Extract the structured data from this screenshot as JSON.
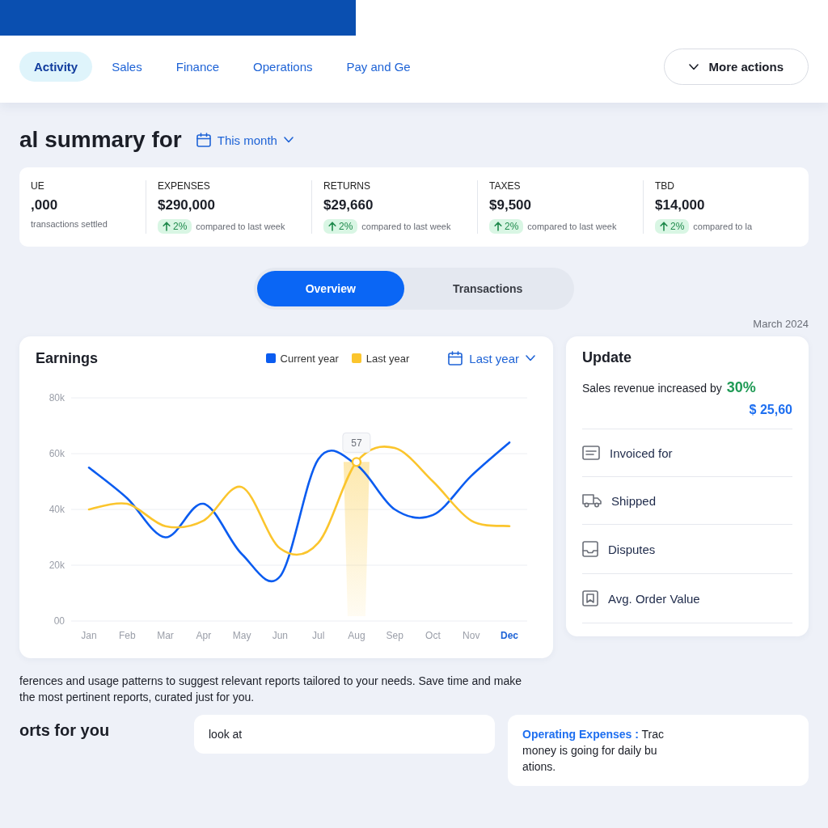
{
  "header": {
    "tabs": [
      {
        "label": "Activity",
        "selected": true
      },
      {
        "label": "Sales",
        "selected": false
      },
      {
        "label": "Finance",
        "selected": false
      },
      {
        "label": "Operations",
        "selected": false
      },
      {
        "label": "Pay and Ge",
        "selected": false
      }
    ],
    "more_actions": {
      "label": "More actions"
    }
  },
  "summary": {
    "title": "al summary for",
    "period": "This month",
    "metrics": [
      {
        "kind": "note",
        "label": "UE",
        "value": ",000",
        "note": "transactions settled"
      },
      {
        "kind": "change",
        "label": "EXPENSES",
        "value": "$290,000",
        "change": "2%",
        "comparison": "compared to last week"
      },
      {
        "kind": "change",
        "label": "RETURNS",
        "value": "$29,660",
        "change": "2%",
        "comparison": "compared to last week"
      },
      {
        "kind": "change",
        "label": "TAXES",
        "value": "$9,500",
        "change": "2%",
        "comparison": "compared to last week"
      },
      {
        "kind": "change",
        "label": "TBD",
        "value": "$14,000",
        "change": "2%",
        "comparison": "compared to la"
      }
    ]
  },
  "view_tabs": [
    {
      "label": "Overview",
      "selected": true
    },
    {
      "label": "Transactions",
      "selected": false
    }
  ],
  "report_date": "March 2024",
  "earnings": {
    "range": "Last year",
    "month_states": [
      {
        "selected": false
      },
      {
        "selected": false
      },
      {
        "selected": false
      },
      {
        "selected": false
      },
      {
        "selected": false
      },
      {
        "selected": false
      },
      {
        "selected": false
      },
      {
        "selected": false
      },
      {
        "selected": false
      },
      {
        "selected": false
      },
      {
        "selected": false
      },
      {
        "selected": true
      }
    ],
    "chart_data": {
      "type": "line",
      "title": "Earnings",
      "categories": [
        "Jan",
        "Feb",
        "Mar",
        "Apr",
        "May",
        "Jun",
        "Jul",
        "Aug",
        "Sep",
        "Oct",
        "Nov",
        "Dec"
      ],
      "series": [
        {
          "name": "Current year",
          "color": "#0b5cf0",
          "values": [
            55,
            44,
            30,
            42,
            24,
            16,
            58,
            56,
            40,
            38,
            52,
            64
          ]
        },
        {
          "name": "Last year",
          "color": "#fbc52d",
          "values": [
            40,
            42,
            34,
            36,
            48,
            26,
            28,
            57,
            62,
            50,
            36,
            34
          ]
        }
      ],
      "ylim": [
        0,
        80
      ],
      "yticks": [
        {
          "value": 0,
          "label": "00"
        },
        {
          "value": 20,
          "label": "20k"
        },
        {
          "value": 40,
          "label": "40k"
        },
        {
          "value": 60,
          "label": "60k"
        },
        {
          "value": 80,
          "label": "80k"
        }
      ],
      "grid": true,
      "annotations": [
        {
          "text": "57",
          "x": "Aug",
          "y": 57
        }
      ]
    }
  },
  "update": {
    "title": "Update",
    "summary": "Sales revenue increased by",
    "growth": "30%",
    "amount": "$ 25,60",
    "rows": [
      {
        "label": "Invoiced for"
      },
      {
        "label": "Shipped"
      },
      {
        "label": "Disputes"
      },
      {
        "label": "Avg. Order Value"
      }
    ]
  },
  "reports": {
    "description_lines": [
      "ferences and usage patterns to suggest relevant reports tailored to your needs. Save time and make",
      "the most pertinent reports, curated just for you."
    ],
    "title": "orts for you",
    "cards": [
      {
        "text_lines": [
          "look at"
        ]
      },
      {
        "link": "Operating Expenses :",
        "text_lines": [
          "Trac",
          "money is going for daily bu",
          "ations."
        ]
      }
    ]
  }
}
